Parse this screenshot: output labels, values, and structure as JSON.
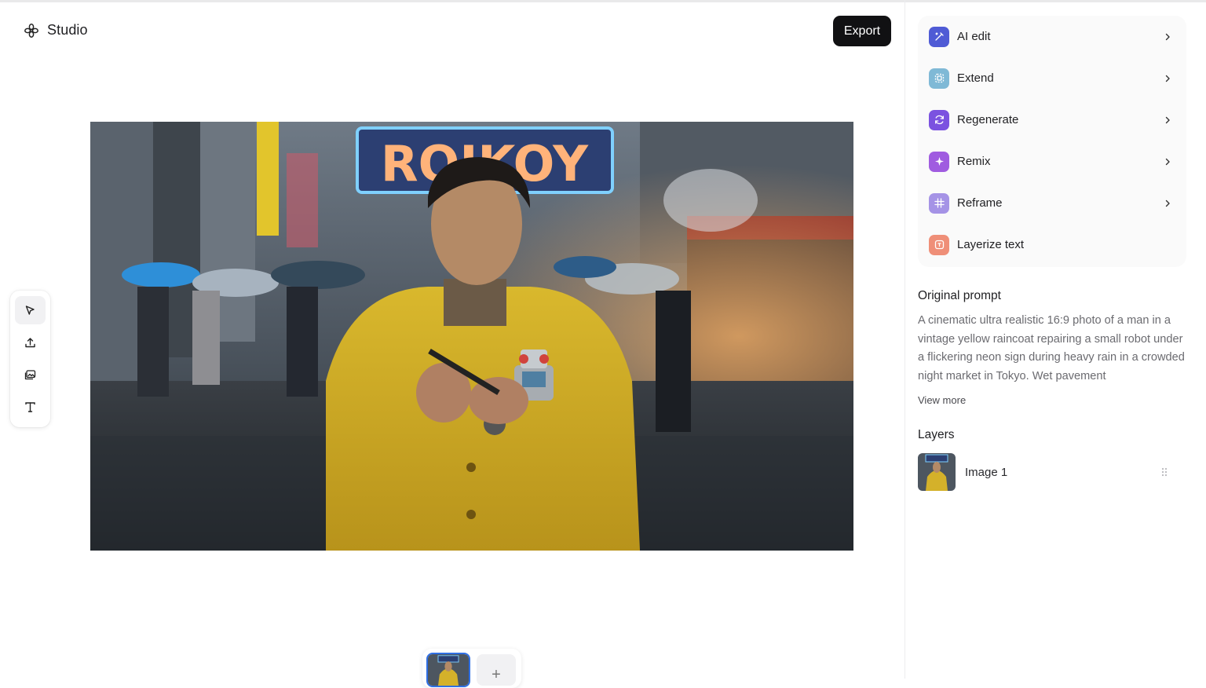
{
  "header": {
    "app_name": "Studio",
    "logo_icon": "flower-icon",
    "export_label": "Export"
  },
  "toolbar": {
    "tools": [
      {
        "icon": "select-cursor-icon",
        "active": true
      },
      {
        "icon": "upload-icon",
        "active": false
      },
      {
        "icon": "images-icon",
        "active": false
      },
      {
        "icon": "text-tool-icon",
        "active": false
      }
    ]
  },
  "canvas": {
    "image_sign_text": "ROIKOY"
  },
  "actions": [
    {
      "label": "AI edit",
      "icon": "ai-edit-icon",
      "color": "#4f5bd5",
      "chevron": true
    },
    {
      "label": "Extend",
      "icon": "extend-icon",
      "color": "#7fb9d6",
      "chevron": true
    },
    {
      "label": "Regenerate",
      "icon": "regenerate-icon",
      "color": "#7b52e0",
      "chevron": true
    },
    {
      "label": "Remix",
      "icon": "remix-sparkle-icon",
      "color": "#a05ce0",
      "chevron": true
    },
    {
      "label": "Reframe",
      "icon": "reframe-grid-icon",
      "color": "#a593e6",
      "chevron": true
    },
    {
      "label": "Layerize text",
      "icon": "layerize-text-icon",
      "color": "#ef8f78",
      "chevron": false
    }
  ],
  "prompt_section": {
    "title": "Original prompt",
    "text": "A cinematic ultra realistic 16:9 photo of a man in a vintage yellow raincoat repairing a small robot under a flickering neon sign during heavy rain in a crowded night market in Tokyo. Wet pavement",
    "view_more": "View more"
  },
  "layers_section": {
    "title": "Layers",
    "items": [
      {
        "name": "Image 1"
      }
    ]
  },
  "colors": {
    "accent": "#2f6fe4",
    "button_dark": "#111113"
  }
}
